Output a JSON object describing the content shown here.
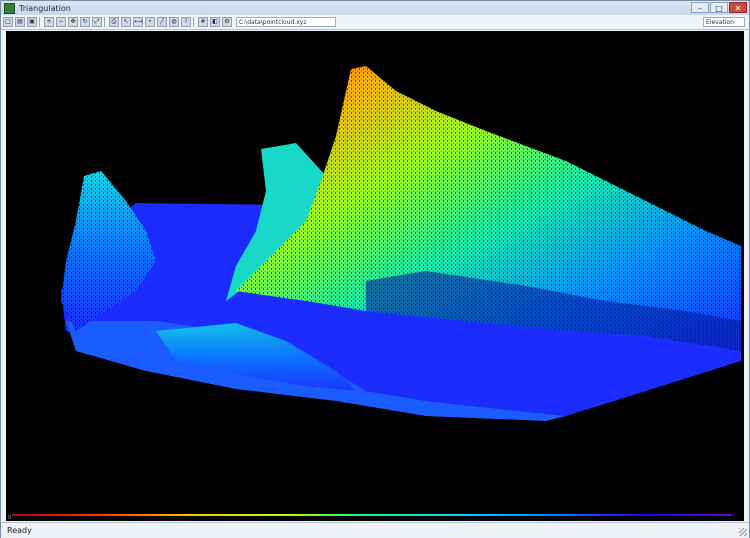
{
  "window": {
    "title": "Triangulation",
    "minimize": "–",
    "maximize": "□",
    "close": "✕"
  },
  "toolbar": {
    "buttons": [
      "new-icon",
      "open-icon",
      "save-icon",
      "zoom-in-icon",
      "zoom-out-icon",
      "pan-icon",
      "rotate-icon",
      "fit-icon",
      "print-icon",
      "select-icon",
      "measure-icon",
      "point-icon",
      "line-icon",
      "globe-icon",
      "help-icon",
      "grid-icon",
      "color-icon",
      "settings-icon"
    ],
    "file_path": "C:\\data\\pointcloud.xyz",
    "view_mode": "Elevation"
  },
  "colors": {
    "ramp": [
      "#b00000",
      "#ff3a00",
      "#ffc800",
      "#b8ff00",
      "#00ff8c",
      "#00d8ff",
      "#0088ff",
      "#1a00ff"
    ],
    "background": "#000000"
  },
  "scale": {
    "min_label": "0",
    "mid_label": "",
    "max_label": ""
  },
  "status": {
    "text": "Ready"
  }
}
